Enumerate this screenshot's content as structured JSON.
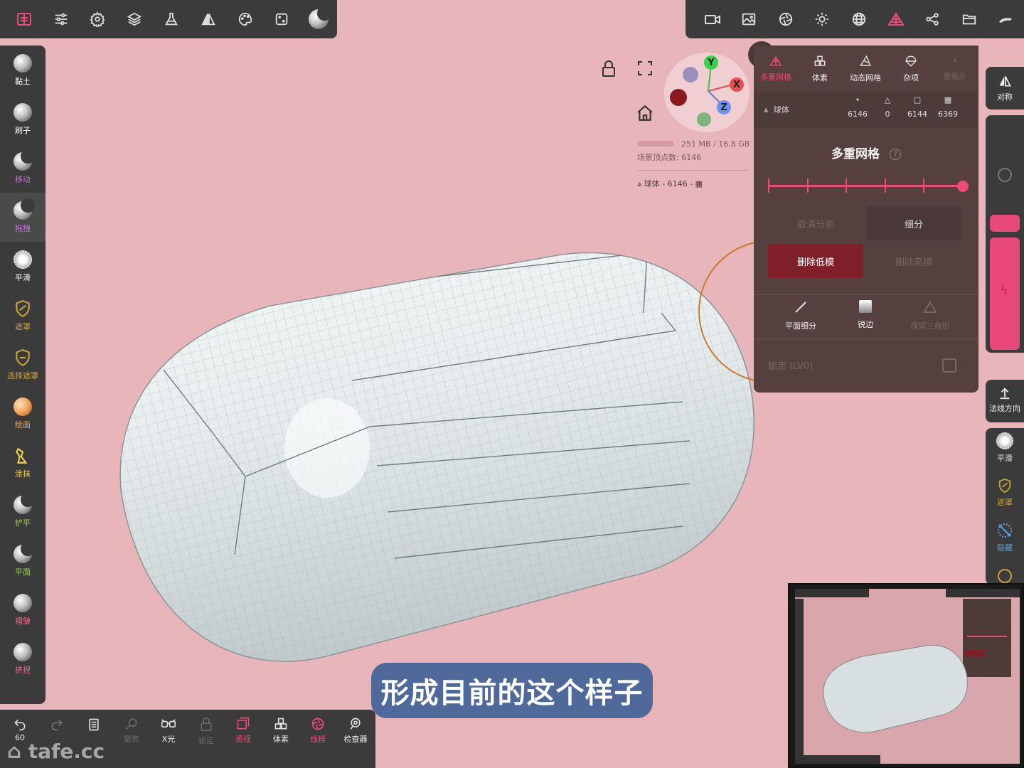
{
  "top_toolbar_left": {
    "icons": [
      "app-logo-icon",
      "sliders-icon",
      "settings-gear-icon",
      "layers-icon",
      "flask-icon",
      "symmetry-icon",
      "palette-icon",
      "dice-icon",
      "matcap-icon"
    ]
  },
  "top_toolbar_right": {
    "icons": [
      "camera-icon",
      "image-icon",
      "aperture-icon",
      "sun-icon",
      "globe-grid-icon",
      "topology-icon",
      "share-nodes-icon",
      "folder-icon",
      "hand-wave-icon"
    ]
  },
  "left_tools": [
    {
      "label": "黏土",
      "color": "#ffffff"
    },
    {
      "label": "刷子",
      "color": "#ffffff"
    },
    {
      "label": "移动",
      "color": "#c46fd6"
    },
    {
      "label": "拖拽",
      "color": "#c46fd6"
    },
    {
      "label": "平滑",
      "color": "#ffffff"
    },
    {
      "label": "遮罩",
      "color": "#c9a13a"
    },
    {
      "label": "选择遮罩",
      "color": "#c9a13a"
    },
    {
      "label": "绘画",
      "color": "#f0a050"
    },
    {
      "label": "涂抹",
      "color": "#f0d24a"
    },
    {
      "label": "铲平",
      "color": "#9ccf4a"
    },
    {
      "label": "平面",
      "color": "#9ccf4a"
    },
    {
      "label": "褶皱",
      "color": "#ee6a8a"
    },
    {
      "label": "挤捏",
      "color": "#ee6a8a"
    }
  ],
  "bottom_toolbar": {
    "undo_count": "60",
    "items": [
      {
        "label": "",
        "icon": "undo-icon"
      },
      {
        "label": "",
        "icon": "redo-icon"
      },
      {
        "label": "",
        "icon": "book-icon"
      },
      {
        "label": "聚焦",
        "icon": "search-icon"
      },
      {
        "label": "X光",
        "icon": "xray-glasses-icon"
      },
      {
        "label": "锁定",
        "icon": "lock-icon"
      },
      {
        "label": "透视",
        "icon": "perspective-icon"
      },
      {
        "label": "体素",
        "icon": "voxel-icon"
      },
      {
        "label": "线框",
        "icon": "wireframe-icon"
      },
      {
        "label": "检查器",
        "icon": "inspector-icon"
      }
    ]
  },
  "viewport_info": {
    "memory": "251 MB / 16.8 GB",
    "vertex_count": "场景顶点数: 6146",
    "mesh_label": "球体 - 6146 -"
  },
  "gizmo": {
    "y": "Y",
    "x": "X",
    "z": "Z"
  },
  "topology_panel": {
    "tabs": [
      {
        "label": "多重网格",
        "active": true
      },
      {
        "label": "体素",
        "active": false
      },
      {
        "label": "动态网格",
        "active": false
      },
      {
        "label": "杂项",
        "active": false
      },
      {
        "label": "重拓扑",
        "active": false
      }
    ],
    "mesh_name": "球体",
    "stats": [
      {
        "symbol": "•",
        "value": "6146"
      },
      {
        "symbol": "△",
        "value": "0"
      },
      {
        "symbol": "□",
        "value": "6144"
      },
      {
        "symbol": "▦",
        "value": "6369"
      }
    ],
    "title": "多重网格",
    "help": "?",
    "level_fraction": 1.0,
    "buttons": {
      "reverse": "取消分割",
      "subdivide": "细分",
      "delete_lower": "删除低模",
      "delete_higher": "删除高模"
    },
    "sub_tools": [
      {
        "label": "平面细分"
      },
      {
        "label": "锐边"
      },
      {
        "label": "保留三角形"
      }
    ],
    "lock_label": "锁定 (LV0)"
  },
  "right_strip": {
    "symmetry_label": "对称",
    "normal_label": "法线方向",
    "smooth_label": "平滑",
    "mask_label": "遮罩",
    "hide_label": "隐藏"
  },
  "subtitle": "形成目前的这个样子",
  "watermark": "tafe.cc",
  "colors": {
    "background": "#e8b5bb",
    "panel": "#3b3b3b",
    "accent": "#ee4a77",
    "delete_button": "#7e1f2a"
  }
}
